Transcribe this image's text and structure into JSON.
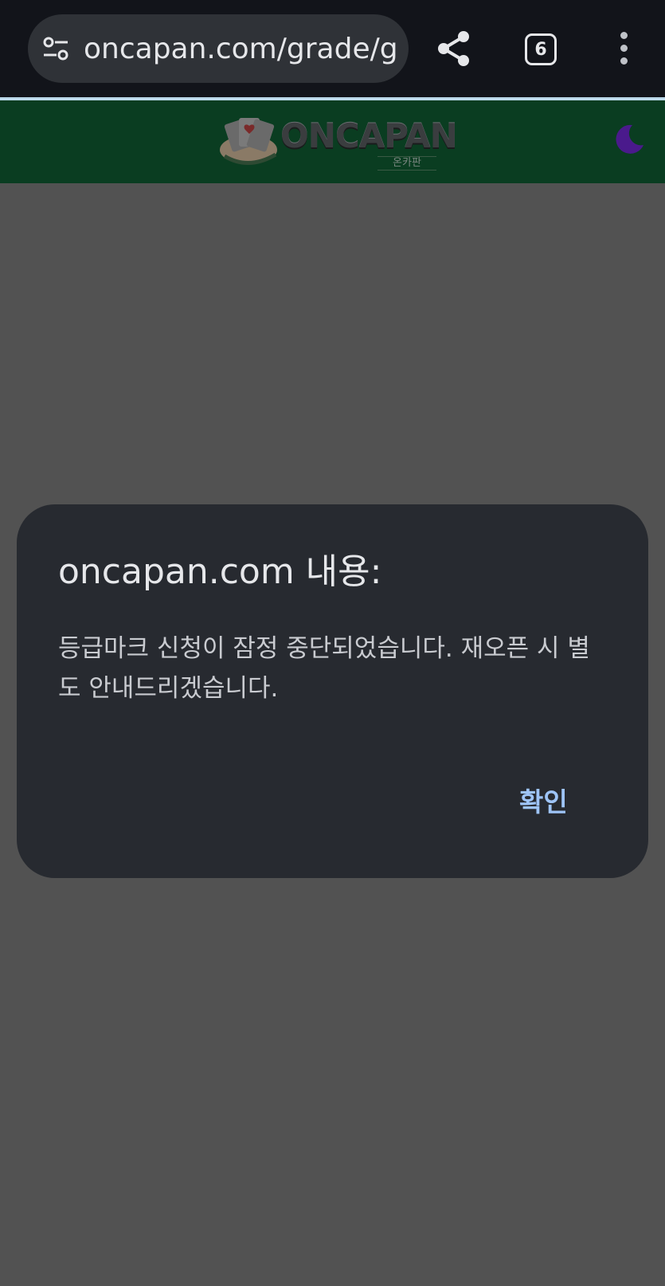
{
  "browser": {
    "url": "oncapan.com/grade/g",
    "tab_count": "6",
    "icons": {
      "site_settings": "tune-icon",
      "share": "share-icon",
      "tabs": "tab-switcher-icon",
      "menu": "more-vert-icon"
    }
  },
  "site": {
    "logo_text": "ONCAPAN",
    "logo_subtext": "온카판",
    "icons": {
      "logo_emblem": "playing-cards-icon",
      "theme_toggle": "moon-icon"
    },
    "colors": {
      "header_bg": "#0a3d21",
      "moon": "#4a1a8c"
    }
  },
  "dialog": {
    "title": "oncapan.com 내용:",
    "message": "등급마크 신청이 잠정 중단되었습니다. 재오픈 시 별도 안내드리겠습니다.",
    "confirm_label": "확인",
    "colors": {
      "background": "#272a30",
      "accent": "#9ec4f7"
    }
  }
}
